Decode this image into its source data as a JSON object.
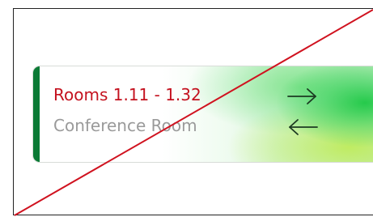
{
  "sign": {
    "title": "Rooms 1.11 - 1.32",
    "subtitle": "Conference Room",
    "right_arrow_icon": "arrow-right-icon",
    "left_arrow_icon": "arrow-left-icon"
  },
  "colors": {
    "title": "#c4121f",
    "subtitle": "#9a9a9a",
    "stripe": "#0b7a35",
    "accent_green": "#28c850",
    "strike_line": "#d0121f"
  }
}
